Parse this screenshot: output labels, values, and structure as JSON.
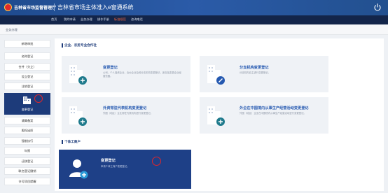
{
  "header": {
    "brand": "吉林省市场监督管理厅",
    "system": "吉林省市场主体准入e窗通系统"
  },
  "nav": {
    "items": [
      "首页",
      "我的申请",
      "业务办理",
      "操作手册",
      "标准规范",
      "咨询电话"
    ],
    "active_index": 4
  },
  "breadcrumb": "业务办理",
  "sidebar": {
    "items": [
      "新增审批",
      "名称登记",
      "合并（分立）",
      "设立登记",
      "注销登记",
      "变更登记",
      "清算备案",
      "股权出质",
      "强制执行",
      "年报",
      "迁移登记",
      "联名登记撤销",
      "许可项目提醒"
    ],
    "active_index": 5
  },
  "sections": [
    {
      "title": "企业、农民专业合作社",
      "cards": [
        {
          "title": "变更登记",
          "desc": "公司、个人独资企业、合伙企业及其分支机构变更登记，还包括变更企业经营范围。"
        },
        {
          "title": "分支机构变更登记",
          "desc": "分支机构自主进行变更登记。"
        },
        {
          "title": "外资常驻代表机构变更登记",
          "desc": "外国（地区）企业常驻代表机构进行变更登记。"
        },
        {
          "title": "外企在中国境内从事生产经营活动变更登记",
          "desc": "外国（地区）企业在中国境内从事生产经营活动进行变更登记。"
        }
      ]
    },
    {
      "title": "个体工商户",
      "cards": [
        {
          "title": "变更登记",
          "desc": "申请个体工商户变更登记。"
        }
      ]
    }
  ],
  "colors": {
    "header": "#2b5ba8",
    "nav": "#13254a",
    "accent_active_nav": "#ff6a3d",
    "sidebar_active": "#1d3b7a",
    "card_title": "#2458b0",
    "annotation_circle": "#e0262a"
  }
}
